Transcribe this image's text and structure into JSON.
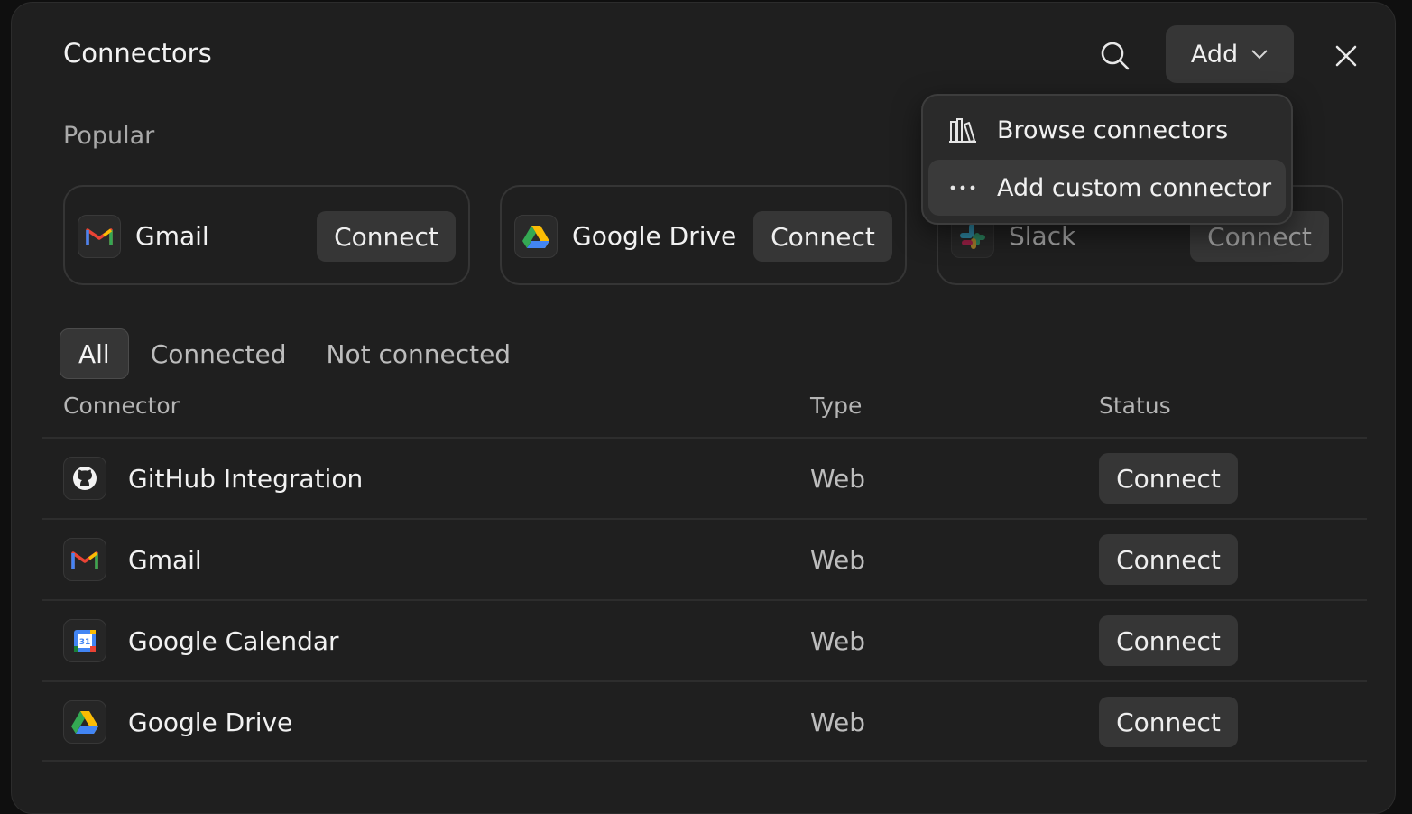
{
  "header": {
    "title": "Connectors",
    "add_label": "Add"
  },
  "add_menu": {
    "items": [
      {
        "label": "Browse connectors",
        "icon": "library-icon"
      },
      {
        "label": "Add custom connector",
        "icon": "ellipsis-icon"
      }
    ]
  },
  "popular": {
    "title": "Popular",
    "cards": [
      {
        "name": "Gmail",
        "icon": "gmail-icon",
        "action": "Connect"
      },
      {
        "name": "Google Drive",
        "icon": "google-drive-icon",
        "action": "Connect"
      },
      {
        "name": "Slack",
        "icon": "slack-icon",
        "action": "Connect"
      }
    ]
  },
  "filters": {
    "tabs": [
      "All",
      "Connected",
      "Not connected"
    ],
    "active": "All"
  },
  "table": {
    "columns": [
      "Connector",
      "Type",
      "Status"
    ],
    "rows": [
      {
        "name": "GitHub Integration",
        "icon": "github-icon",
        "type": "Web",
        "action": "Connect"
      },
      {
        "name": "Gmail",
        "icon": "gmail-icon",
        "type": "Web",
        "action": "Connect"
      },
      {
        "name": "Google Calendar",
        "icon": "google-calendar-icon",
        "type": "Web",
        "action": "Connect"
      },
      {
        "name": "Google Drive",
        "icon": "google-drive-icon",
        "type": "Web",
        "action": "Connect"
      }
    ]
  },
  "colors": {
    "background": "#1f1f1f",
    "button": "#363636",
    "text": "#f1f1f1",
    "muted_text": "#b5b5b5"
  }
}
